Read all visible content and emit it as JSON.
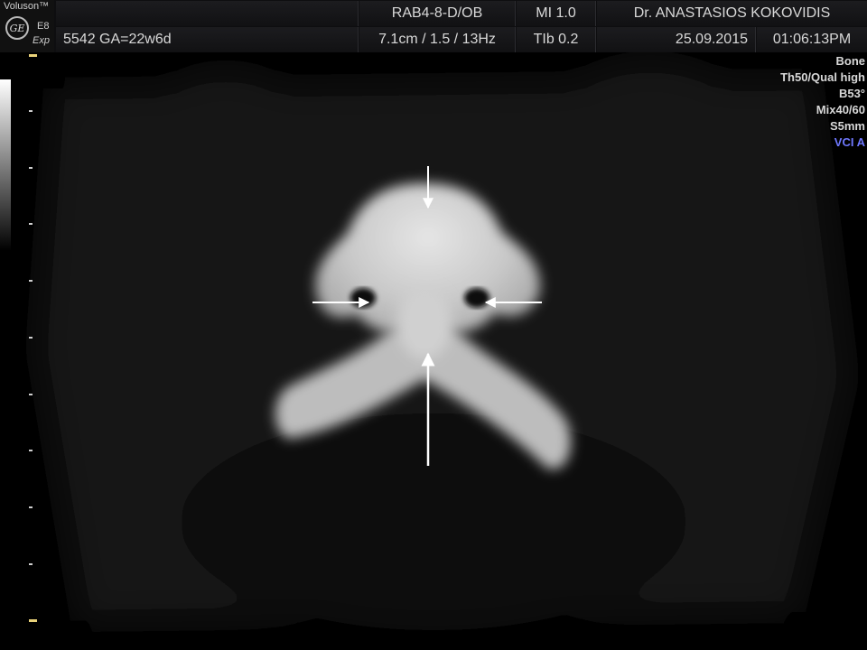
{
  "logo": {
    "brand": "Voluson™",
    "model": "E8",
    "edition": "Exp",
    "ge_mark": "GE"
  },
  "header": {
    "patient_id_ga": "5542  GA=22w6d",
    "probe": "RAB4-8-D/OB",
    "depth_settings": "7.1cm / 1.5 / 13Hz",
    "mi": "MI  1.0",
    "tib": "TIb  0.2",
    "operator": "Dr. ANASTASIOS KOKOVIDIS",
    "date": "25.09.2015",
    "time": "01:06:13PM"
  },
  "settings": {
    "items": [
      "Bone",
      "Th50/Qual high",
      "B53°",
      "Mix40/60",
      "S5mm",
      "VCI A"
    ],
    "accent_color": "#6f78ff"
  },
  "scale_marker_color": "#e9d27a",
  "annotations": {
    "arrows": [
      "arrow-top",
      "arrow-left",
      "arrow-right",
      "arrow-bottom"
    ]
  }
}
